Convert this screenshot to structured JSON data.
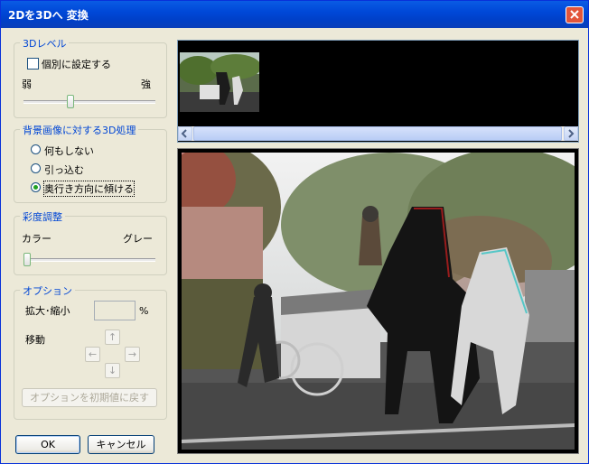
{
  "window": {
    "title": "2Dを3Dへ 変換"
  },
  "level_group": {
    "title": "3Dレベル",
    "individual_checkbox_label": "個別に設定する",
    "individual_checked": false,
    "weak_label": "弱",
    "strong_label": "強",
    "level_value": 0.35
  },
  "bg_group": {
    "title": "背景画像に対する3D処理",
    "options": [
      "何もしない",
      "引っ込む",
      "奥行き方向に傾ける"
    ],
    "selected_index": 2
  },
  "saturation_group": {
    "title": "彩度調整",
    "color_label": "カラー",
    "gray_label": "グレー",
    "saturation_value": 0.0
  },
  "options_group": {
    "title": "オプション",
    "zoom_label": "拡大･縮小",
    "zoom_value": "",
    "percent_label": "%",
    "move_label": "移動",
    "arrows": {
      "up": "↑",
      "left": "←",
      "right": "→",
      "down": "↓"
    },
    "reset_button": "オプションを初期値に戻す"
  },
  "buttons": {
    "ok": "OK",
    "cancel": "キャンセル"
  },
  "colors": {
    "title_bar": "#0a5ce4",
    "group_title": "#0046d5",
    "close_button": "#e2553a"
  },
  "icons": {
    "close": "close-icon",
    "scroll_left": "arrow-left-icon",
    "scroll_right": "arrow-right-icon"
  }
}
